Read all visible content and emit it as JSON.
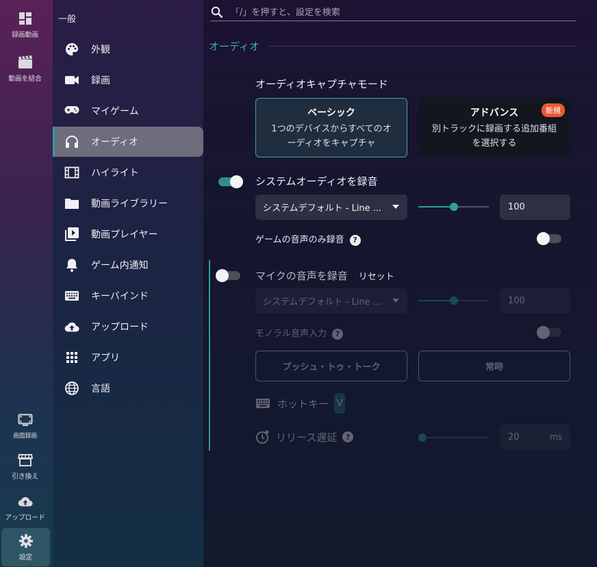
{
  "rail": {
    "top_items": [
      {
        "icon": "dashboard-icon",
        "label": "録画動画"
      },
      {
        "icon": "film-clip-icon",
        "label": "動画を結合"
      }
    ],
    "bottom_items": [
      {
        "icon": "monitor-icon",
        "label": "画面録画"
      },
      {
        "icon": "store-icon",
        "label": "引き換え"
      },
      {
        "icon": "cloud-upload-icon",
        "label": "アップロード"
      },
      {
        "icon": "gear-icon",
        "label": "設定"
      }
    ]
  },
  "sidebar": {
    "section": "一般",
    "items": [
      {
        "icon": "palette-icon",
        "label": "外観"
      },
      {
        "icon": "video-camera-icon",
        "label": "録画"
      },
      {
        "icon": "gamepad-icon",
        "label": "マイゲーム"
      },
      {
        "icon": "headphones-icon",
        "label": "オーディオ"
      },
      {
        "icon": "film-strip-icon",
        "label": "ハイライト"
      },
      {
        "icon": "folder-icon",
        "label": "動画ライブラリー"
      },
      {
        "icon": "video-library-icon",
        "label": "動画プレイヤー"
      },
      {
        "icon": "bell-icon",
        "label": "ゲーム内通知"
      },
      {
        "icon": "keyboard-icon",
        "label": "キーバインド"
      },
      {
        "icon": "cloud-upload-icon",
        "label": "アップロード"
      },
      {
        "icon": "apps-grid-icon",
        "label": "アプリ"
      },
      {
        "icon": "globe-icon",
        "label": "言語"
      }
    ],
    "active_index": 3
  },
  "search": {
    "placeholder": "「/」を押すと、設定を検索"
  },
  "audio": {
    "section_title": "オーディオ",
    "capture_mode_title": "オーディオキャプチャモード",
    "modes": {
      "basic": {
        "title": "ベーシック",
        "desc_1": "1つのデバイスからすべてのオ",
        "desc_2": "ーディオをキャプチャ",
        "selected": true
      },
      "advanced": {
        "title": "アドバンス",
        "desc_1": "別トラックに録画する追加番組",
        "desc_2": "を選択する",
        "badge": "新規",
        "selected": false
      }
    },
    "system": {
      "label": "システムオーディオを録音",
      "enabled": true,
      "device": "システムデフォルト - Line ...",
      "volume_level": 0.5,
      "volume_value": "100",
      "game_only_label": "ゲームの音声のみ録音",
      "game_only_enabled": false
    },
    "mic": {
      "label": "マイクの音声を録音",
      "reset_label": "リセット",
      "enabled": false,
      "device": "システムデフォルト - Line ...",
      "volume_level": 0.5,
      "volume_value": "100",
      "mono_label": "モノラル音声入力",
      "mono_enabled": false,
      "ptt_label": "プッシュ・トゥ・トーク",
      "always_label": "常時",
      "hotkey_label": "ホットキー",
      "hotkey_value": "V",
      "release_label": "リリース遅延",
      "release_level": 0,
      "release_value": "20",
      "release_unit": "ms"
    }
  },
  "colors": {
    "accent": "#2fa09e",
    "badge": "#e85a33"
  }
}
